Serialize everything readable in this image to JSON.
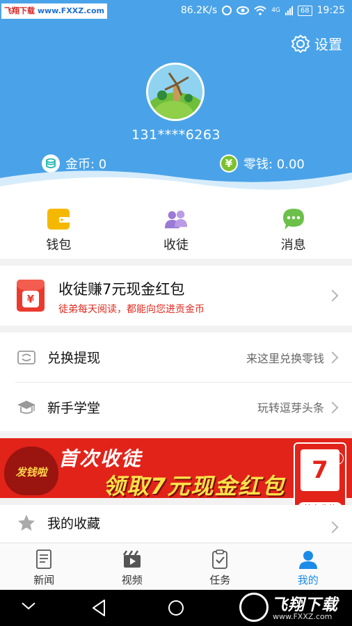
{
  "status_bar": {
    "watermark_left": "飞翔下载",
    "watermark_url": "www.FXXZ.com",
    "speed": "86.2K/s",
    "network": "4G",
    "battery": "68",
    "time": "19:25"
  },
  "header": {
    "settings_label": "设置",
    "phone": "131****6263",
    "coins_label": "金币: 0",
    "cash_label": "零钱: 0.00",
    "cash_icon_glyph": "¥"
  },
  "shortcuts": [
    {
      "label": "钱包",
      "icon": "wallet-icon",
      "color": "#f5b800"
    },
    {
      "label": "收徒",
      "icon": "people-icon",
      "color": "#9b7ad6"
    },
    {
      "label": "消息",
      "icon": "chat-icon",
      "color": "#6cc04a"
    }
  ],
  "invite": {
    "title": "收徒赚7元现金红包",
    "subtitle": "徒弟每天阅读，都能向您进贡金币",
    "icon_glyph": "¥"
  },
  "list": [
    {
      "label": "兑换提现",
      "hint": "来这里兑换零钱",
      "icon": "exchange-icon"
    },
    {
      "label": "新手学堂",
      "hint": "玩转逗芽头条",
      "icon": "graduation-cap-icon"
    }
  ],
  "ad": {
    "line1": "首次收徒",
    "line2": "领取7元现金红包",
    "bag_text": "发钱啦",
    "card_number": "7",
    "card_label": "首次收徒",
    "close_glyph": "×"
  },
  "favorites": {
    "label": "我的收藏"
  },
  "bottom_nav": [
    {
      "label": "新闻",
      "icon": "news-icon",
      "active": false
    },
    {
      "label": "视频",
      "icon": "video-icon",
      "active": false
    },
    {
      "label": "任务",
      "icon": "task-icon",
      "active": false
    },
    {
      "label": "我的",
      "icon": "user-icon",
      "active": true
    }
  ],
  "watermark_bottom": {
    "title": "飞翔下载",
    "url": "www.FXXZ.com"
  },
  "colors": {
    "primary": "#4aa3e8",
    "accent_red": "#e2231a",
    "active_tab": "#1a8ce8"
  }
}
